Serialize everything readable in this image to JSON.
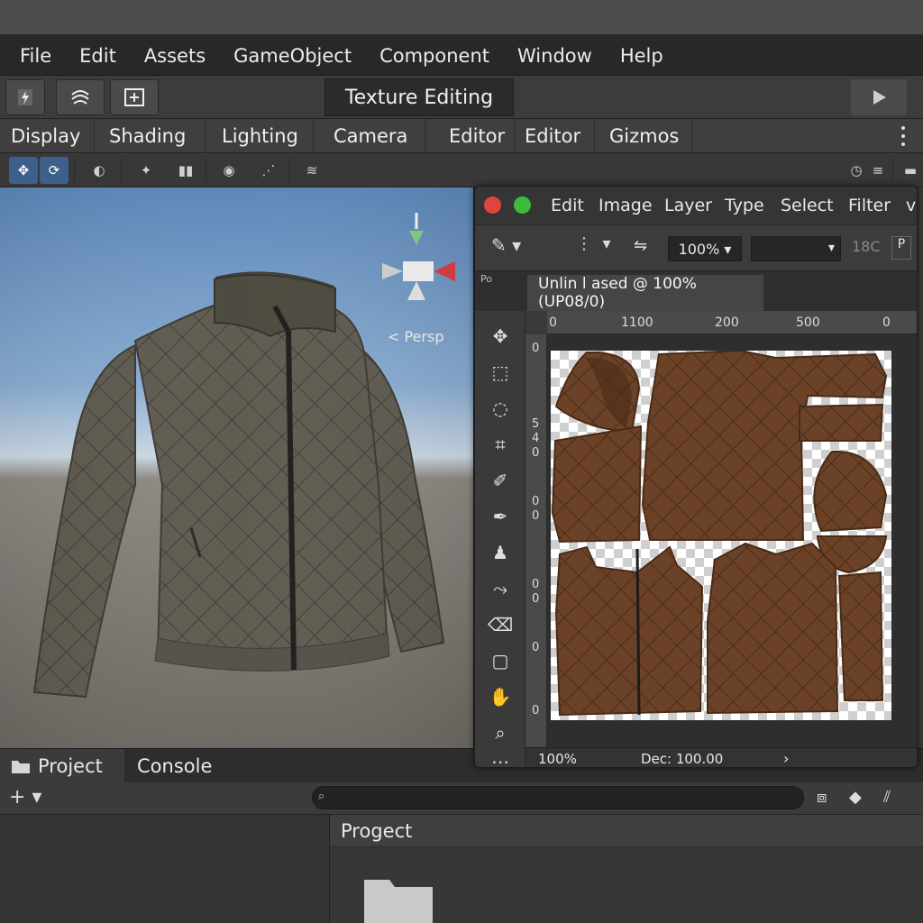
{
  "menubar": {
    "items": [
      "File",
      "Edit",
      "Assets",
      "GameObject",
      "Component",
      "Window",
      "Help"
    ]
  },
  "toolbar": {
    "mode_title": "Texture Editing"
  },
  "scene_tabs": [
    "Display",
    "Shading",
    "Lighting",
    "Camera",
    "Editor",
    "Editor",
    "Gizmos"
  ],
  "viewport": {
    "projection_label": "< Persp"
  },
  "project_panel": {
    "tabs": [
      "Project",
      "Console"
    ],
    "header": "Progect"
  },
  "photoshop": {
    "menu": [
      "Edit",
      "Image",
      "Layer",
      "Type",
      "Select",
      "Filter",
      "v"
    ],
    "zoom_value": "100%",
    "doc_tab": "Unlin l ased @ 100% (UP08/0)",
    "ruler_top": [
      "0",
      "1100",
      "200",
      "500",
      "0"
    ],
    "ruler_left": [
      "0",
      "5",
      "4",
      "0",
      "0",
      "0",
      "0",
      "0",
      "0",
      "0"
    ],
    "status_zoom": "100%",
    "status_doc": "Dec: 100.00",
    "toolbar_label": "Po",
    "size_field": "18C"
  },
  "colors": {
    "accent_blue": "#3d5f8c",
    "jacket": "#5e5a4e",
    "uv_leather": "#6b4227",
    "close_dot": "#e0443f",
    "max_dot": "#3dbb3d"
  }
}
